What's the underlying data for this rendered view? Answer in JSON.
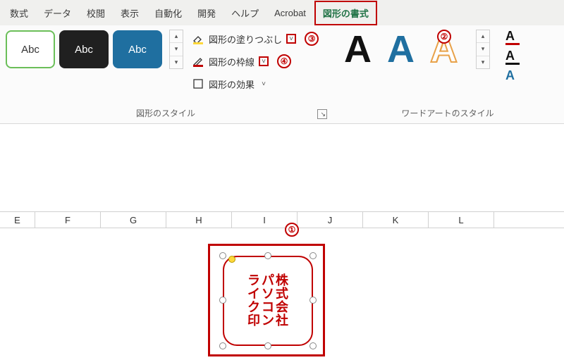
{
  "tabs": {
    "formula": "数式",
    "data": "データ",
    "review": "校閲",
    "view": "表示",
    "automate": "自動化",
    "developer": "開発",
    "help": "ヘルプ",
    "acrobat": "Acrobat",
    "shape_format": "図形の書式"
  },
  "ribbon": {
    "shape_styles": {
      "item_label": "Abc",
      "group_label": "図形のスタイル",
      "fill_label": "図形の塗りつぶし",
      "outline_label": "図形の枠線",
      "effects_label": "図形の効果"
    },
    "wordart": {
      "glyph": "A",
      "group_label": "ワードアートのスタイル"
    }
  },
  "annotations": {
    "n1": "①",
    "n2": "②",
    "n3": "③",
    "n4": "④"
  },
  "sheet": {
    "cols": [
      "E",
      "F",
      "G",
      "H",
      "I",
      "J",
      "K",
      "L"
    ]
  },
  "shape_text": {
    "col1": [
      "株",
      "式",
      "会",
      "社"
    ],
    "col2": [
      "パ",
      "ソ",
      "コ",
      "ン"
    ],
    "col3": [
      "ラ",
      "イ",
      "ク",
      "印"
    ]
  }
}
